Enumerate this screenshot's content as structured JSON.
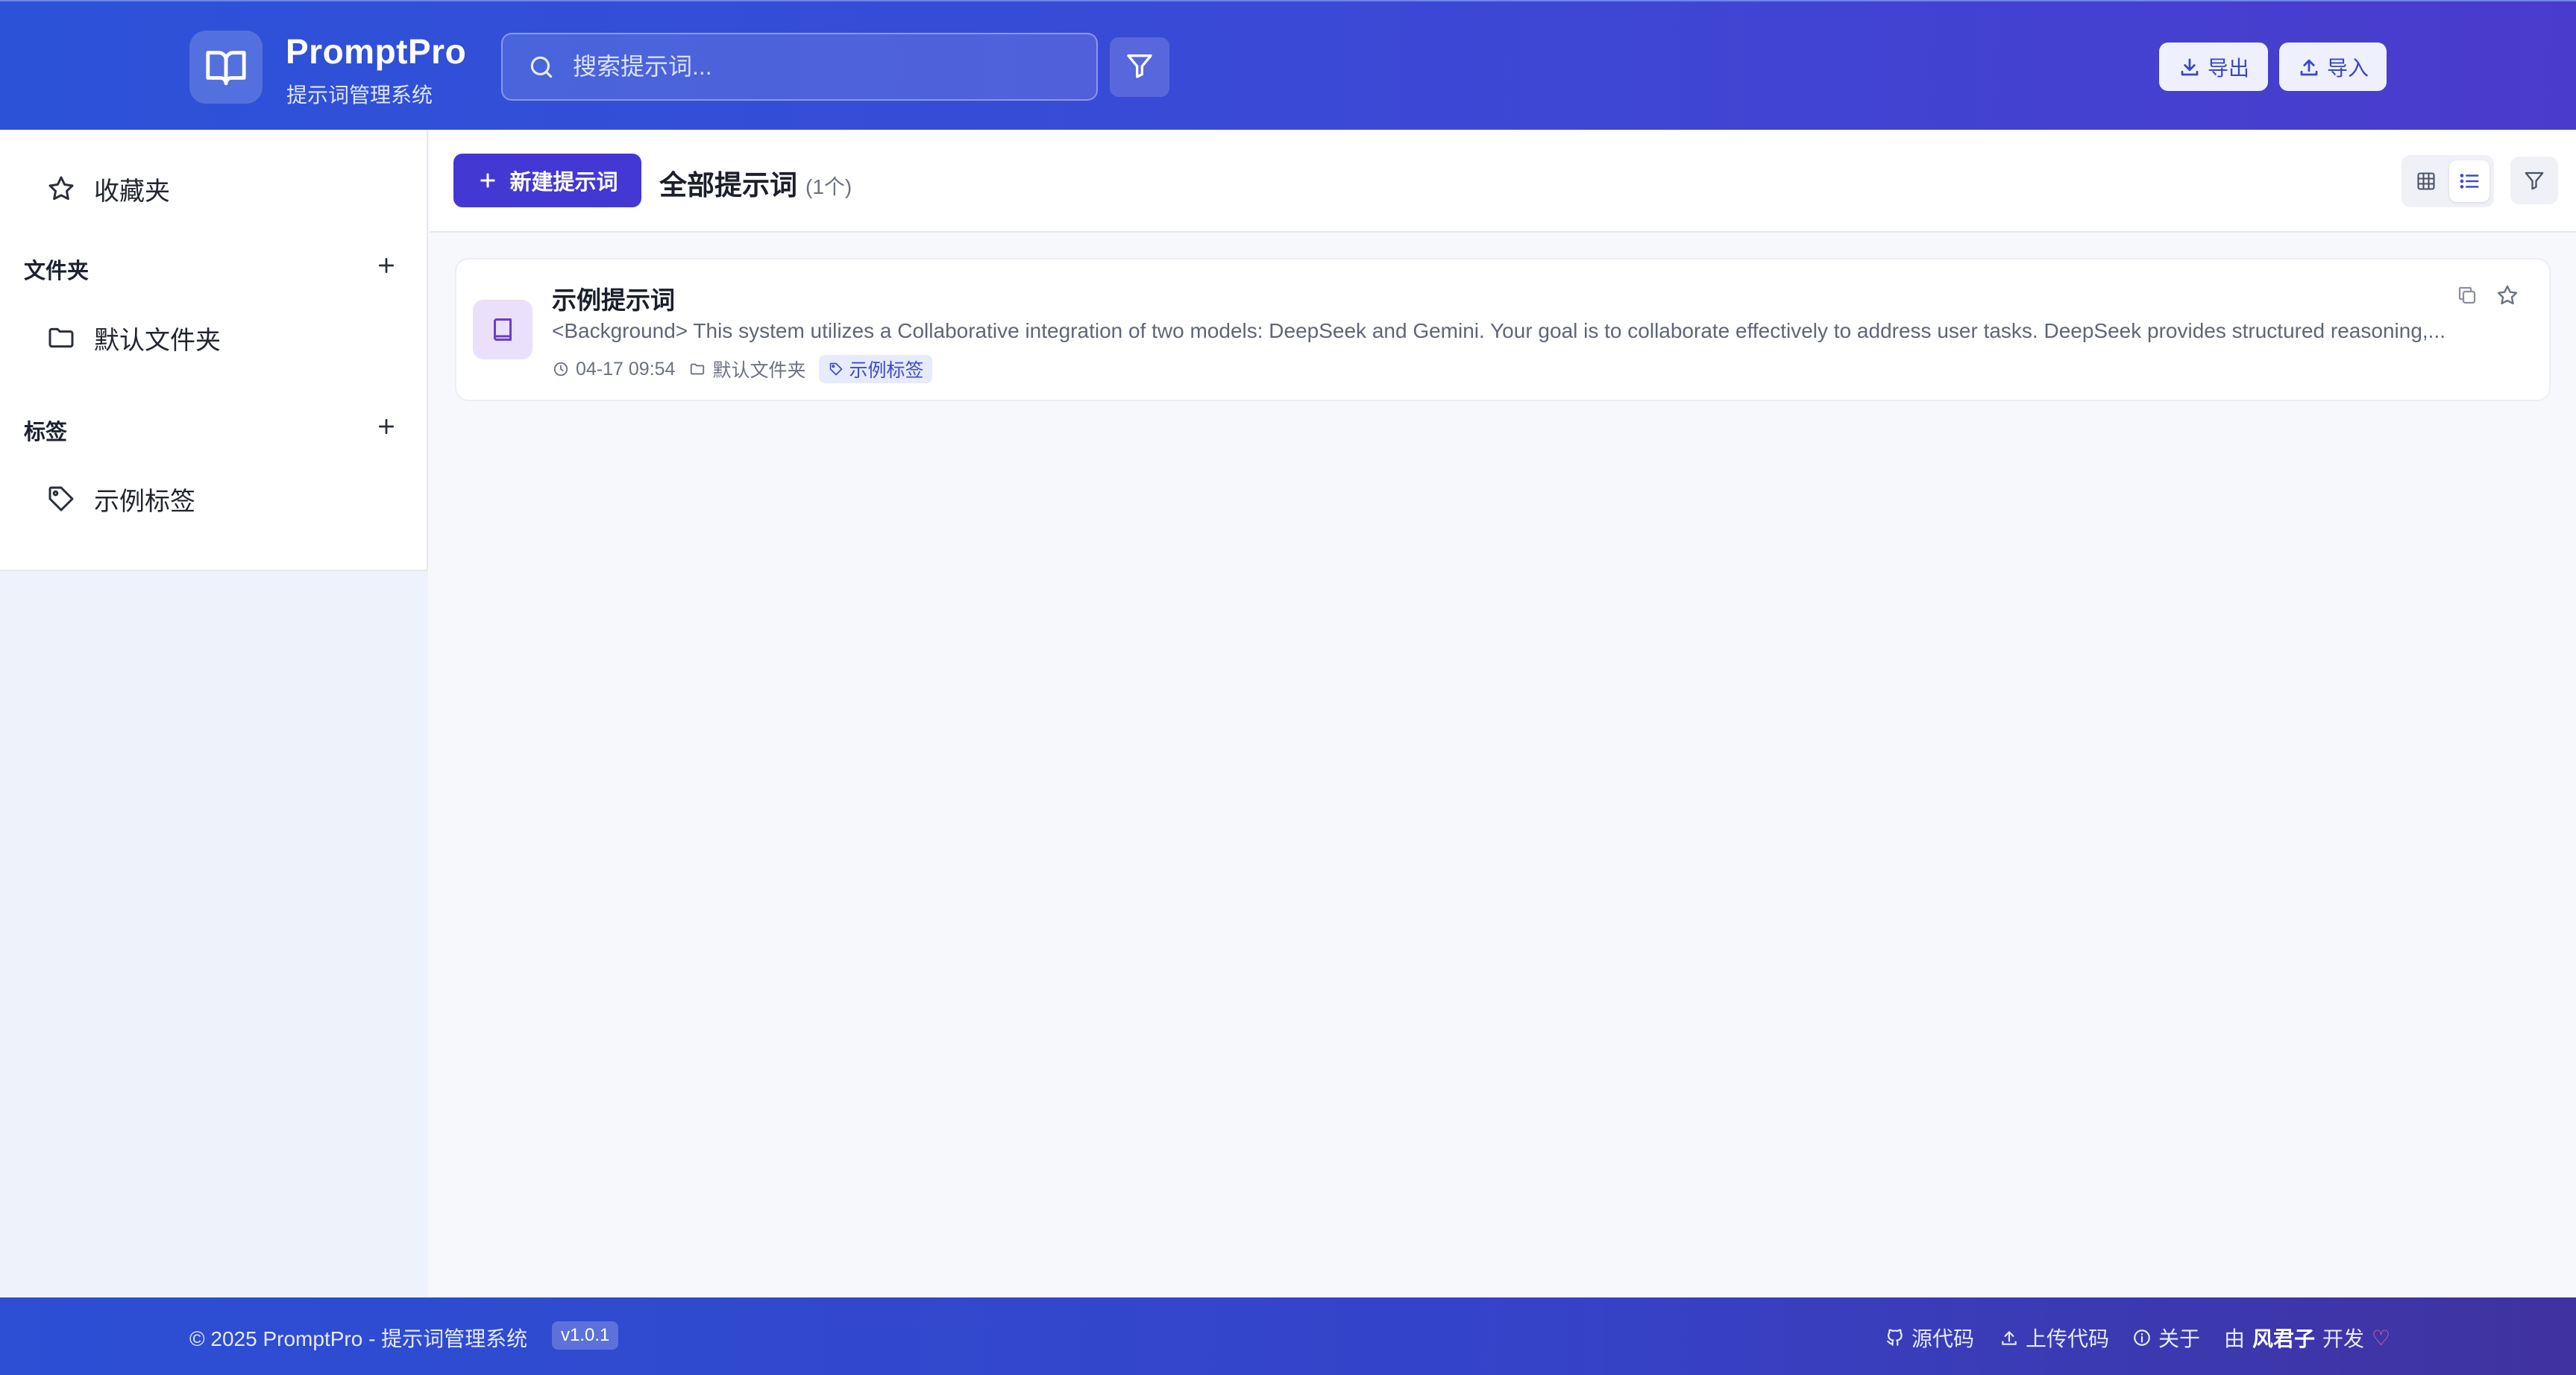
{
  "app": {
    "name": "PromptPro",
    "subtitle": "提示词管理系统"
  },
  "header": {
    "search_placeholder": "搜索提示词...",
    "export_label": "导出",
    "import_label": "导入"
  },
  "sidebar": {
    "favorites_label": "收藏夹",
    "folders_section": "文件夹",
    "folders": [
      "默认文件夹"
    ],
    "tags_section": "标签",
    "tags": [
      "示例标签"
    ]
  },
  "toolbar": {
    "new_button": "新建提示词",
    "title": "全部提示词",
    "count": "(1个)"
  },
  "prompts": [
    {
      "title": "示例提示词",
      "description": "<Background> This system utilizes a Collaborative integration of two models: DeepSeek and Gemini. Your goal is to collaborate effectively to address user tasks. DeepSeek provides structured reasoning,...",
      "time": "04-17 09:54",
      "folder": "默认文件夹",
      "tag": "示例标签"
    }
  ],
  "footer": {
    "copyright": "© 2025 PromptPro - 提示词管理系统",
    "version": "v1.0.1",
    "source_link": "源代码",
    "upload_link": "上传代码",
    "about_link": "关于",
    "dev_prefix": "由",
    "dev_name": "风君子",
    "dev_suffix": "开发",
    "heart": "♡"
  },
  "colors": {
    "primary": "#4438d4",
    "header_start": "#2c52d8",
    "header_end": "#4a3bcc",
    "tag_bg": "#e6ebfd",
    "tag_text": "#3f4bc9"
  }
}
